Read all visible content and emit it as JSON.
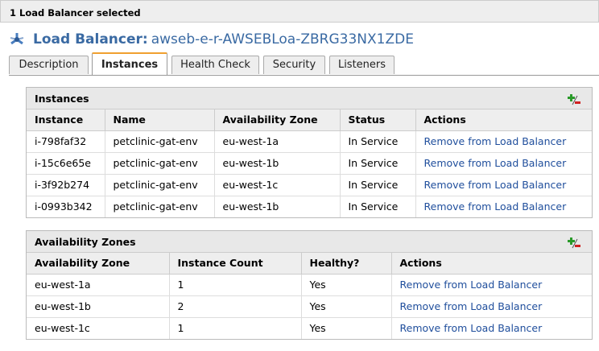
{
  "selection_text": "1 Load Balancer selected",
  "header": {
    "label": "Load Balancer:",
    "name": "awseb-e-r-AWSEBLoa-ZBRG33NX1ZDE"
  },
  "tabs": [
    {
      "label": "Description",
      "active": false
    },
    {
      "label": "Instances",
      "active": true
    },
    {
      "label": "Health Check",
      "active": false
    },
    {
      "label": "Security",
      "active": false
    },
    {
      "label": "Listeners",
      "active": false
    }
  ],
  "instances_panel": {
    "title": "Instances",
    "columns": [
      "Instance",
      "Name",
      "Availability Zone",
      "Status",
      "Actions"
    ],
    "rows": [
      {
        "instance": "i-798faf32",
        "name": "petclinic-gat-env",
        "zone": "eu-west-1a",
        "status": "In Service",
        "action": "Remove from Load Balancer"
      },
      {
        "instance": "i-15c6e65e",
        "name": "petclinic-gat-env",
        "zone": "eu-west-1b",
        "status": "In Service",
        "action": "Remove from Load Balancer"
      },
      {
        "instance": "i-3f92b274",
        "name": "petclinic-gat-env",
        "zone": "eu-west-1c",
        "status": "In Service",
        "action": "Remove from Load Balancer"
      },
      {
        "instance": "i-0993b342",
        "name": "petclinic-gat-env",
        "zone": "eu-west-1b",
        "status": "In Service",
        "action": "Remove from Load Balancer"
      }
    ]
  },
  "zones_panel": {
    "title": "Availability Zones",
    "columns": [
      "Availability Zone",
      "Instance Count",
      "Healthy?",
      "Actions"
    ],
    "rows": [
      {
        "zone": "eu-west-1a",
        "count": "1",
        "healthy": "Yes",
        "action": "Remove from Load Balancer"
      },
      {
        "zone": "eu-west-1b",
        "count": "2",
        "healthy": "Yes",
        "action": "Remove from Load Balancer"
      },
      {
        "zone": "eu-west-1c",
        "count": "1",
        "healthy": "Yes",
        "action": "Remove from Load Balancer"
      }
    ]
  },
  "icons": {
    "title_icon": "load-balancer-icon",
    "add_remove": "add-remove-icon"
  },
  "colors": {
    "title": "#3a6aa3",
    "link": "#1f4e9c",
    "active_tab_accent": "#f0a030"
  }
}
